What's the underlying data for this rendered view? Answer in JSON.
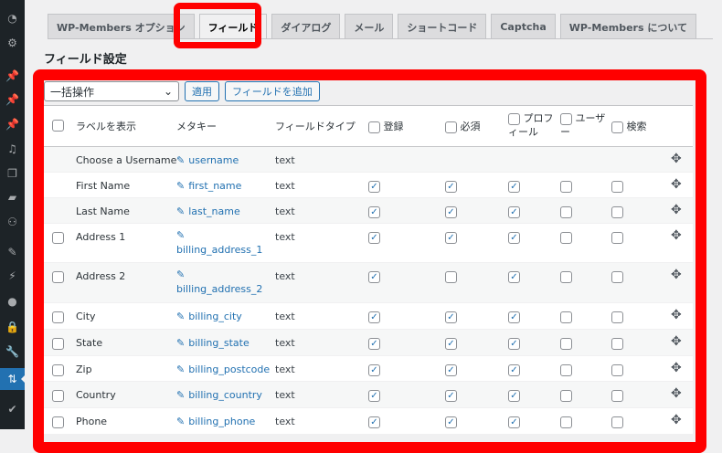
{
  "sidebar": {
    "items": [
      {
        "icon": "dashboard-icon",
        "g": "◔"
      },
      {
        "icon": "gear-icon",
        "g": "⚙"
      },
      {
        "icon": "pin-icon",
        "g": "📌"
      },
      {
        "icon": "pin-icon",
        "g": "📌"
      },
      {
        "icon": "pin-icon",
        "g": "📌"
      },
      {
        "icon": "media-icon",
        "g": "♫"
      },
      {
        "icon": "pages-icon",
        "g": "❐"
      },
      {
        "icon": "comments-icon",
        "g": "▰"
      },
      {
        "icon": "users-group-icon",
        "g": "⚇"
      },
      {
        "icon": "appearance-icon",
        "g": "✎"
      },
      {
        "icon": "plugins-icon",
        "g": "⚡"
      },
      {
        "icon": "user-icon",
        "g": "●"
      },
      {
        "icon": "lock-icon",
        "g": "🔒"
      },
      {
        "icon": "tools-icon",
        "g": "🔧"
      },
      {
        "icon": "settings-icon",
        "g": "⇅"
      },
      {
        "icon": "shield-icon",
        "g": "✔"
      }
    ]
  },
  "tabs": [
    "WP-Members オプション",
    "フィールド",
    "ダイアログ",
    "メール",
    "ショートコード",
    "Captcha",
    "WP-Members について"
  ],
  "active_tab": 1,
  "page_title": "フィールド設定",
  "toolbar": {
    "bulk": "一括操作",
    "apply": "適用",
    "add": "フィールドを追加"
  },
  "headers": {
    "label": "ラベルを表示",
    "meta": "メタキー",
    "type": "フィールドタイプ",
    "register": "登録",
    "required": "必須",
    "profile": "プロフ\nィール",
    "users": "ユーザ\nー",
    "search": "検索"
  },
  "rows": [
    {
      "label": "Choose a Username",
      "meta": "username",
      "type": "text",
      "sel": false,
      "flags": null
    },
    {
      "label": "First Name",
      "meta": "first_name",
      "type": "text",
      "sel": false,
      "flags": [
        true,
        true,
        true,
        false,
        false
      ]
    },
    {
      "label": "Last Name",
      "meta": "last_name",
      "type": "text",
      "sel": false,
      "flags": [
        true,
        true,
        true,
        false,
        false
      ]
    },
    {
      "label": "Address 1",
      "meta": "billing_address_1",
      "type": "text",
      "sel": true,
      "wrap": true,
      "flags": [
        true,
        true,
        true,
        false,
        false
      ]
    },
    {
      "label": "Address 2",
      "meta": "billing_address_2",
      "type": "text",
      "sel": true,
      "wrap": true,
      "flags": [
        true,
        false,
        true,
        false,
        false
      ]
    },
    {
      "label": "City",
      "meta": "billing_city",
      "type": "text",
      "sel": true,
      "flags": [
        true,
        true,
        true,
        false,
        false
      ]
    },
    {
      "label": "State",
      "meta": "billing_state",
      "type": "text",
      "sel": true,
      "flags": [
        true,
        true,
        true,
        false,
        false
      ]
    },
    {
      "label": "Zip",
      "meta": "billing_postcode",
      "type": "text",
      "sel": true,
      "flags": [
        true,
        true,
        true,
        false,
        false
      ]
    },
    {
      "label": "Country",
      "meta": "billing_country",
      "type": "text",
      "sel": true,
      "flags": [
        true,
        true,
        true,
        false,
        false
      ]
    },
    {
      "label": "Phone",
      "meta": "billing_phone",
      "type": "text",
      "sel": true,
      "flags": [
        true,
        true,
        true,
        false,
        false
      ]
    }
  ]
}
